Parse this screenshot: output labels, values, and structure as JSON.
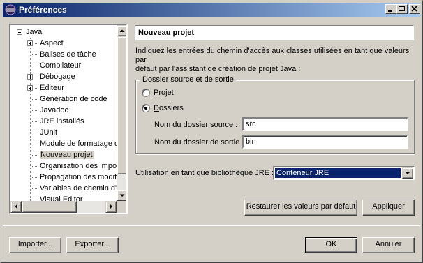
{
  "window": {
    "title": "Préférences",
    "icon": "eclipse-icon"
  },
  "tree": {
    "items": [
      {
        "label": "Java",
        "expander": "minus",
        "level": 0
      },
      {
        "label": "Aspect",
        "expander": "plus",
        "level": 1
      },
      {
        "label": "Balises de tâche",
        "level": 1
      },
      {
        "label": "Compilateur",
        "level": 1
      },
      {
        "label": "Débogage",
        "expander": "plus",
        "level": 1
      },
      {
        "label": "Editeur",
        "expander": "plus",
        "level": 1
      },
      {
        "label": "Génération de code",
        "level": 1
      },
      {
        "label": "Javadoc",
        "level": 1
      },
      {
        "label": "JRE installés",
        "level": 1
      },
      {
        "label": "JUnit",
        "level": 1
      },
      {
        "label": "Module de formatage d",
        "level": 1
      },
      {
        "label": "Nouveau projet",
        "level": 1,
        "selected": true
      },
      {
        "label": "Organisation des import",
        "level": 1
      },
      {
        "label": "Propagation des modific",
        "level": 1
      },
      {
        "label": "Variables de chemin d'a",
        "level": 1
      },
      {
        "label": "Visual Editor",
        "level": 1
      }
    ]
  },
  "page": {
    "title": "Nouveau projet",
    "description_line1": "Indiquez les entrées du chemin d'accès aux classes utilisées en tant que valeurs par",
    "description_line2": "défaut par l'assistant de création de projet Java :",
    "group": {
      "title": "Dossier source et de sortie",
      "radio_project": {
        "label": "Projet",
        "selected": false
      },
      "radio_folders": {
        "label": "Dossiers",
        "selected": true
      },
      "source_label": "Nom du dossier source :",
      "source_value": "src",
      "output_label": "Nom du dossier de sortie :",
      "output_value": "bin"
    },
    "jre_label": "Utilisation en tant que bibliothèque JRE :",
    "jre_value": "Conteneur JRE",
    "restore_button": "Restaurer les valeurs par défaut",
    "apply_button": "Appliquer"
  },
  "footer": {
    "import_button": "Importer...",
    "export_button": "Exporter...",
    "ok_button": "OK",
    "cancel_button": "Annuler"
  }
}
